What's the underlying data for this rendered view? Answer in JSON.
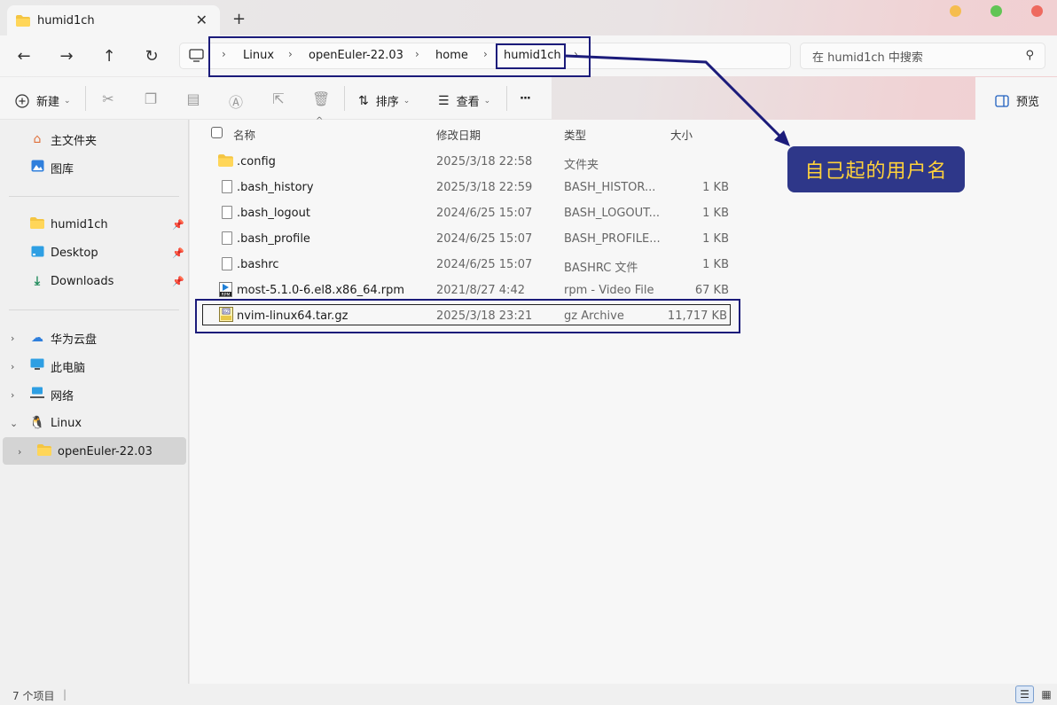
{
  "tab": {
    "title": "humid1ch",
    "close": "✕",
    "new": "+"
  },
  "window": {
    "colors": {
      "min": "#f5bd4f",
      "max": "#61c554",
      "close": "#ee6a5f"
    }
  },
  "nav": {
    "back": "←",
    "forward": "→",
    "up": "↑",
    "refresh": "↻"
  },
  "breadcrumb": [
    "Linux",
    "openEuler-22.03",
    "home",
    "humid1ch"
  ],
  "search": {
    "placeholder": "在 humid1ch 中搜索"
  },
  "toolbar": {
    "new_label": "新建",
    "sort_label": "排序",
    "view_label": "查看",
    "more": "···",
    "preview_label": "预览"
  },
  "sidebar": {
    "quick": [
      {
        "label": "主文件夹",
        "icon": "home-icon"
      },
      {
        "label": "图库",
        "icon": "gallery-icon"
      }
    ],
    "pinned": [
      {
        "label": "humid1ch",
        "icon": "folder-icon"
      },
      {
        "label": "Desktop",
        "icon": "desktop-icon"
      },
      {
        "label": "Downloads",
        "icon": "download-icon"
      }
    ],
    "tree": [
      {
        "label": "华为云盘",
        "icon": "cloud-icon"
      },
      {
        "label": "此电脑",
        "icon": "pc-icon"
      },
      {
        "label": "网络",
        "icon": "network-icon"
      },
      {
        "label": "Linux",
        "icon": "linux-icon"
      }
    ],
    "selected": {
      "label": "openEuler-22.03",
      "icon": "folder-icon"
    }
  },
  "columns": {
    "name": "名称",
    "date": "修改日期",
    "type": "类型",
    "size": "大小"
  },
  "files": [
    {
      "name": ".config",
      "date": "2025/3/18 22:58",
      "type": "文件夹",
      "size": "",
      "icon": "folder-icon"
    },
    {
      "name": ".bash_history",
      "date": "2025/3/18 22:59",
      "type": "BASH_HISTOR...",
      "size": "1 KB",
      "icon": "file-icon"
    },
    {
      "name": ".bash_logout",
      "date": "2024/6/25 15:07",
      "type": "BASH_LOGOUT...",
      "size": "1 KB",
      "icon": "file-icon"
    },
    {
      "name": ".bash_profile",
      "date": "2024/6/25 15:07",
      "type": "BASH_PROFILE...",
      "size": "1 KB",
      "icon": "file-icon"
    },
    {
      "name": ".bashrc",
      "date": "2024/6/25 15:07",
      "type": "BASHRC 文件",
      "size": "1 KB",
      "icon": "file-icon"
    },
    {
      "name": "most-5.1.0-6.el8.x86_64.rpm",
      "date": "2021/8/27 4:42",
      "type": "rpm - Video File",
      "size": "67 KB",
      "icon": "rpm-icon"
    },
    {
      "name": "nvim-linux64.tar.gz",
      "date": "2025/3/18 23:21",
      "type": "gz Archive",
      "size": "11,717 KB",
      "icon": "archive-icon"
    }
  ],
  "status": {
    "count": "7 个项目"
  },
  "annotation": {
    "callout": "自己起的用户名"
  }
}
